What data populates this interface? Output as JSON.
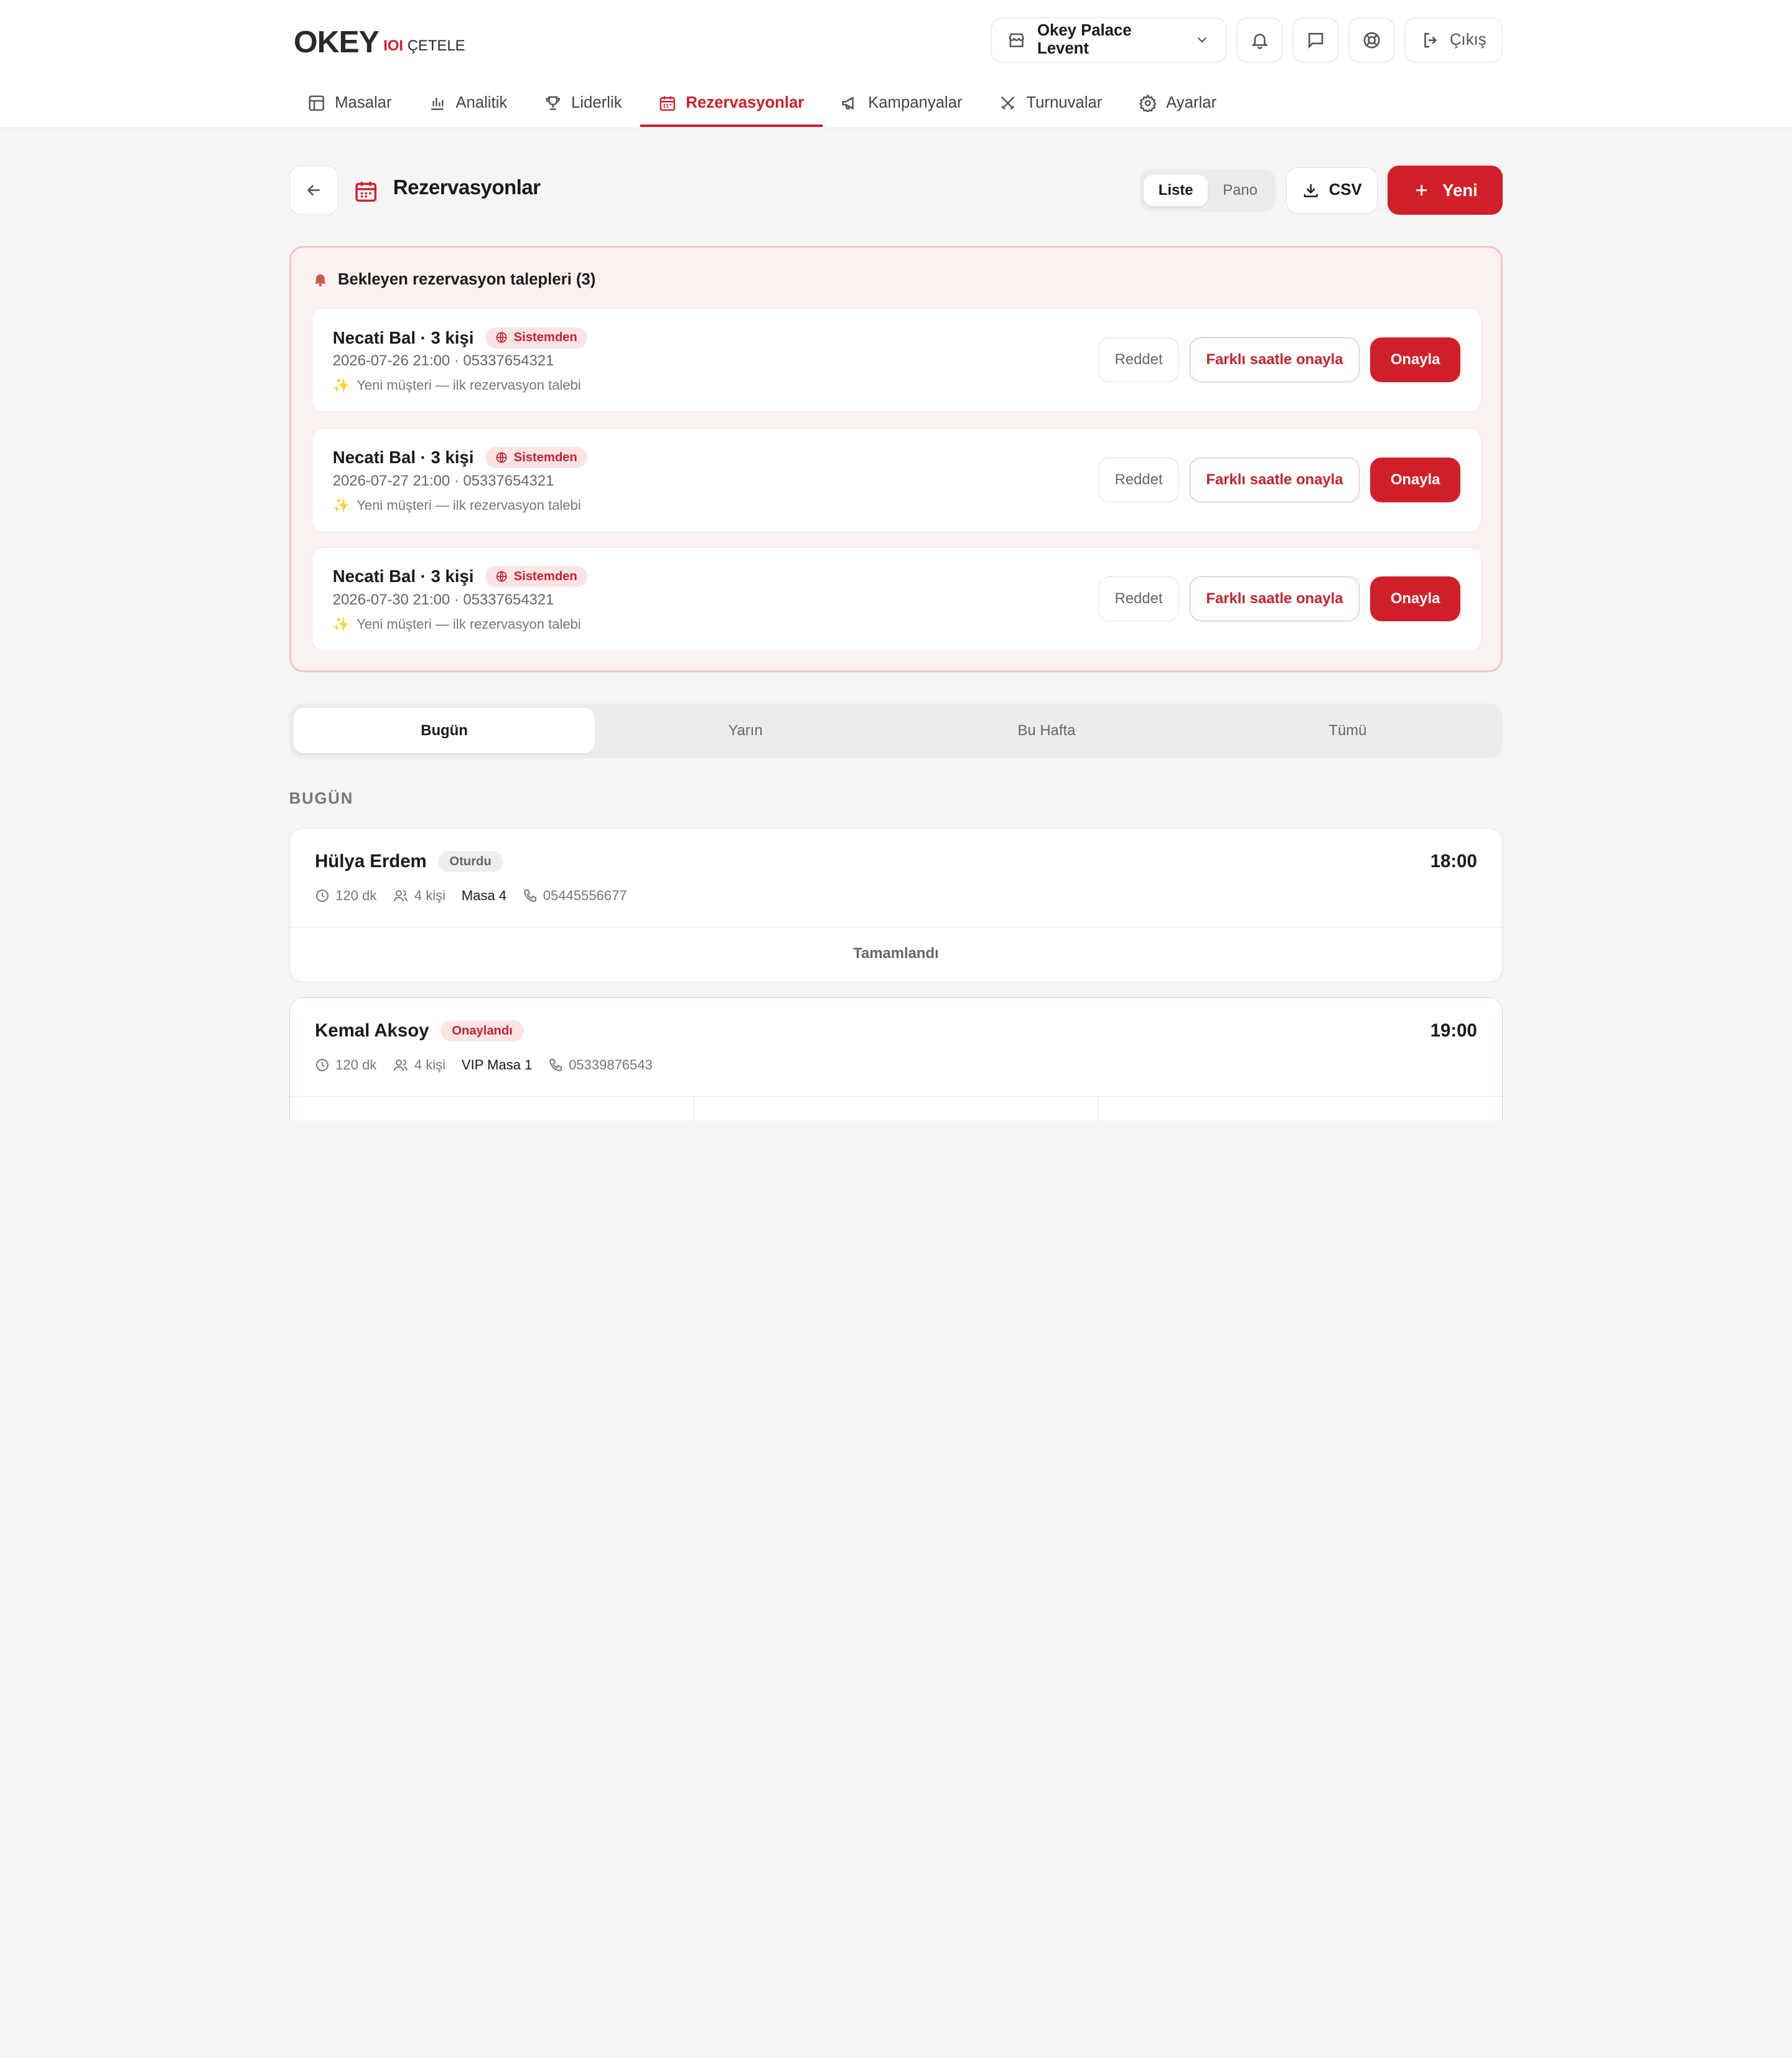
{
  "brand": {
    "logo_main": "OKEY",
    "logo_sub_mark": "IOI",
    "logo_sub_text": "ÇETELE",
    "accent_color": "#d11f2a"
  },
  "header": {
    "venue": "Okey Palace Levent",
    "exit_label": "Çıkış",
    "nav": [
      {
        "label": "Masalar",
        "icon": "table-icon"
      },
      {
        "label": "Analitik",
        "icon": "bar-chart-icon"
      },
      {
        "label": "Liderlik",
        "icon": "trophy-icon"
      },
      {
        "label": "Rezervasyonlar",
        "icon": "calendar-icon",
        "active": true
      },
      {
        "label": "Kampanyalar",
        "icon": "megaphone-icon"
      },
      {
        "label": "Turnuvalar",
        "icon": "swords-icon"
      },
      {
        "label": "Ayarlar",
        "icon": "gear-icon"
      }
    ]
  },
  "page": {
    "title": "Rezervasyonlar",
    "view_toggle": [
      "Liste",
      "Pano"
    ],
    "view_selected": "Liste",
    "csv_label": "CSV",
    "new_label": "Yeni"
  },
  "pending": {
    "title": "Bekleyen rezervasyon talepleri (3)",
    "reject_label": "Reddet",
    "alt_label": "Farklı saatle onayla",
    "approve_label": "Onayla",
    "items": [
      {
        "name": "Necati Bal · 3 kişi",
        "source": "Sistemden",
        "meta": "2026-07-26 21:00 · 05337654321",
        "note": "Yeni müşteri — ilk rezervasyon talebi"
      },
      {
        "name": "Necati Bal · 3 kişi",
        "source": "Sistemden",
        "meta": "2026-07-27 21:00 · 05337654321",
        "note": "Yeni müşteri — ilk rezervasyon talebi"
      },
      {
        "name": "Necati Bal · 3 kişi",
        "source": "Sistemden",
        "meta": "2026-07-30 21:00 · 05337654321",
        "note": "Yeni müşteri — ilk rezervasyon talebi"
      }
    ]
  },
  "filters": {
    "tabs": [
      "Bugün",
      "Yarın",
      "Bu Hafta",
      "Tümü"
    ],
    "selected": "Bugün"
  },
  "section_label": "BUGÜN",
  "reservations": [
    {
      "name": "Hülya Erdem",
      "status": "Oturdu",
      "time": "18:00",
      "duration": "120 dk",
      "people": "4 kişi",
      "table": "Masa 4",
      "phone": "05445556677",
      "footer": "Tamamlandı"
    },
    {
      "name": "Kemal Aksoy",
      "status": "Onaylandı",
      "time": "19:00",
      "duration": "120 dk",
      "people": "4 kişi",
      "table": "VIP Masa 1",
      "phone": "05339876543"
    }
  ]
}
